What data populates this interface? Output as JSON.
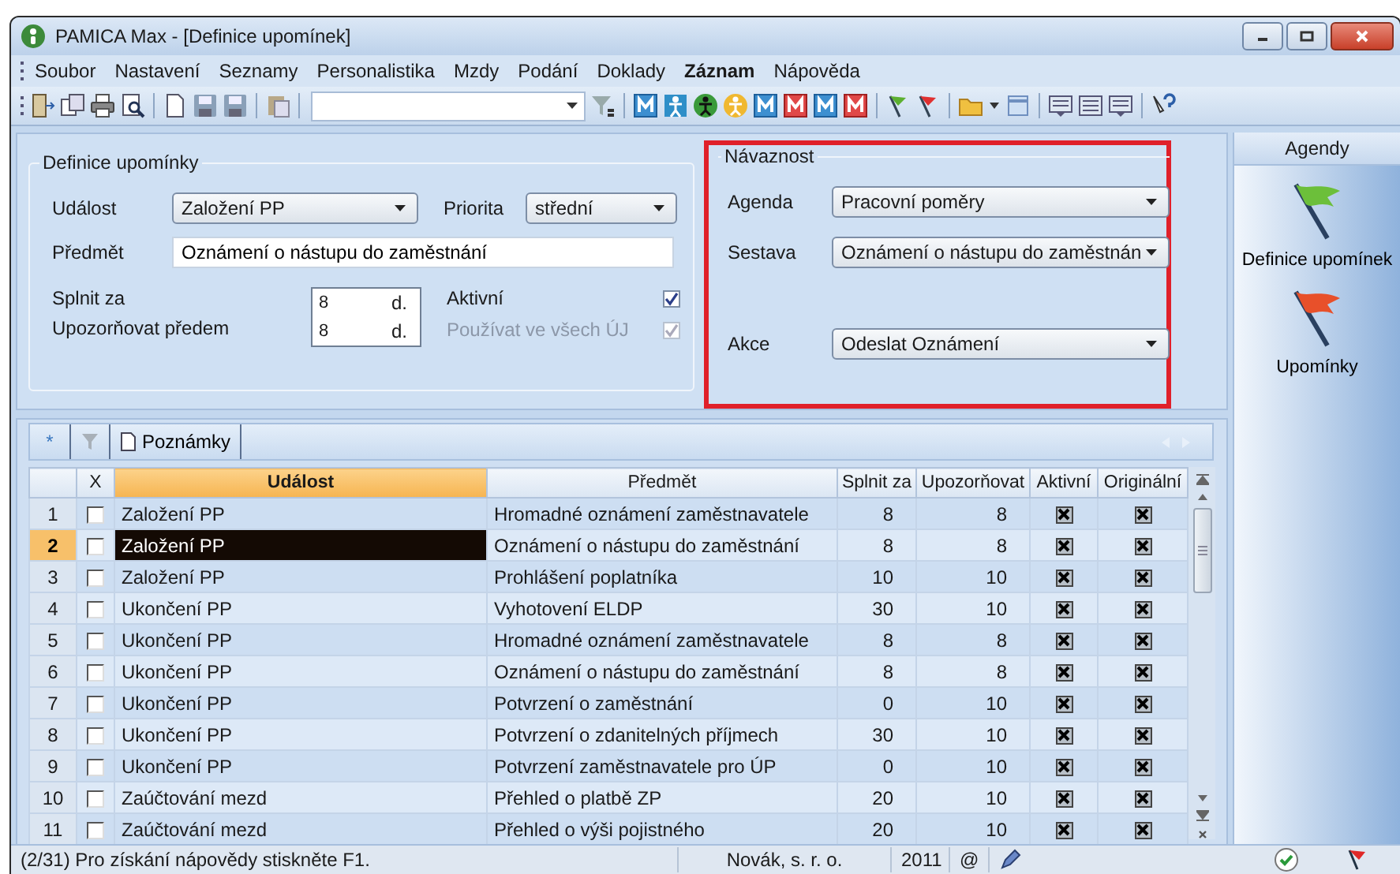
{
  "window": {
    "title": "PAMICA Max - [Definice upomínek]"
  },
  "menu": [
    {
      "label": "Soubor",
      "highlighted": false
    },
    {
      "label": "Nastavení",
      "highlighted": false
    },
    {
      "label": "Seznamy",
      "highlighted": false
    },
    {
      "label": "Personalistika",
      "highlighted": false
    },
    {
      "label": "Mzdy",
      "highlighted": false
    },
    {
      "label": "Podání",
      "highlighted": false
    },
    {
      "label": "Doklady",
      "highlighted": false
    },
    {
      "label": "Záznam",
      "highlighted": true
    },
    {
      "label": "Nápověda",
      "highlighted": false
    }
  ],
  "definice": {
    "title": "Definice upomínky",
    "udalost": {
      "label": "Událost",
      "value": "Založení PP"
    },
    "priorita": {
      "label": "Priorita",
      "value": "střední"
    },
    "predmet": {
      "label": "Předmět",
      "value": "Oznámení o nástupu do zaměstnání"
    },
    "splnit_za": {
      "label": "Splnit za",
      "value": "8",
      "unit": "d."
    },
    "upozornovat": {
      "label": "Upozorňovat předem",
      "value": "8",
      "unit": "d."
    },
    "aktivni": {
      "label": "Aktivní",
      "checked": true,
      "disabled": false
    },
    "vsech_uj": {
      "label": "Používat ve všech ÚJ",
      "checked": true,
      "disabled": true
    }
  },
  "navaznost": {
    "title": "Návaznost",
    "highlighted": true,
    "agenda": {
      "label": "Agenda",
      "value": "Pracovní poměry"
    },
    "sestava": {
      "label": "Sestava",
      "value": "Oznámení o nástupu do zaměstnán"
    },
    "akce": {
      "label": "Akce",
      "value": "Odeslat Oznámení"
    }
  },
  "agendy": {
    "title": "Agendy",
    "items": [
      {
        "label": "Definice upomínek",
        "color": "#6cbf3a"
      },
      {
        "label": "Upomínky",
        "color": "#e8502a"
      }
    ]
  },
  "grid": {
    "tabs": [
      {
        "kind": "new",
        "label": "*"
      },
      {
        "kind": "filter"
      },
      {
        "kind": "notes",
        "label": "Poznámky"
      }
    ],
    "columns": [
      {
        "label": "X",
        "selected": false
      },
      {
        "label": "Událost",
        "selected": true
      },
      {
        "label": "Předmět",
        "selected": false
      },
      {
        "label": "Splnit za",
        "selected": false
      },
      {
        "label": "Upozorňovat",
        "selected": false
      },
      {
        "label": "Aktivní",
        "selected": false
      },
      {
        "label": "Originální",
        "selected": false
      }
    ],
    "rows": [
      {
        "number": "1",
        "selected": false,
        "checked": false,
        "udalost": "Založení PP",
        "predmet": "Hromadné oznámení zaměstnavatele",
        "splnit_za": "8",
        "upozornovat": "8",
        "aktivni": true,
        "originalni": true
      },
      {
        "number": "2",
        "selected": true,
        "checked": false,
        "udalost": "Založení PP",
        "predmet": "Oznámení o nástupu do zaměstnání",
        "splnit_za": "8",
        "upozornovat": "8",
        "aktivni": true,
        "originalni": true
      },
      {
        "number": "3",
        "selected": false,
        "checked": false,
        "udalost": "Založení PP",
        "predmet": "Prohlášení poplatníka",
        "splnit_za": "10",
        "upozornovat": "10",
        "aktivni": true,
        "originalni": true
      },
      {
        "number": "4",
        "selected": false,
        "checked": false,
        "udalost": "Ukončení PP",
        "predmet": "Vyhotovení ELDP",
        "splnit_za": "30",
        "upozornovat": "10",
        "aktivni": true,
        "originalni": true
      },
      {
        "number": "5",
        "selected": false,
        "checked": false,
        "udalost": "Ukončení PP",
        "predmet": "Hromadné oznámení zaměstnavatele",
        "splnit_za": "8",
        "upozornovat": "8",
        "aktivni": true,
        "originalni": true
      },
      {
        "number": "6",
        "selected": false,
        "checked": false,
        "udalost": "Ukončení PP",
        "predmet": "Oznámení o nástupu do zaměstnání",
        "splnit_za": "8",
        "upozornovat": "8",
        "aktivni": true,
        "originalni": true
      },
      {
        "number": "7",
        "selected": false,
        "checked": false,
        "udalost": "Ukončení PP",
        "predmet": "Potvrzení o zaměstnání",
        "splnit_za": "0",
        "upozornovat": "10",
        "aktivni": true,
        "originalni": true
      },
      {
        "number": "8",
        "selected": false,
        "checked": false,
        "udalost": "Ukončení PP",
        "predmet": "Potvrzení o zdanitelných příjmech",
        "splnit_za": "30",
        "upozornovat": "10",
        "aktivni": true,
        "originalni": true
      },
      {
        "number": "9",
        "selected": false,
        "checked": false,
        "udalost": "Ukončení PP",
        "predmet": "Potvrzení zaměstnavatele pro ÚP",
        "splnit_za": "0",
        "upozornovat": "10",
        "aktivni": true,
        "originalni": true
      },
      {
        "number": "10",
        "selected": false,
        "checked": false,
        "udalost": "Zaúčtování mezd",
        "predmet": "Přehled o platbě ZP",
        "splnit_za": "20",
        "upozornovat": "10",
        "aktivni": true,
        "originalni": true
      },
      {
        "number": "11",
        "selected": false,
        "checked": false,
        "udalost": "Zaúčtování mezd",
        "predmet": "Přehled o výši pojistného",
        "splnit_za": "20",
        "upozornovat": "10",
        "aktivni": true,
        "originalni": true
      }
    ]
  },
  "status_bar": {
    "message": "(2/31) Pro získání nápovědy stiskněte F1.",
    "company": "Novák, s. r. o.",
    "year": "2011",
    "mail": "@"
  }
}
